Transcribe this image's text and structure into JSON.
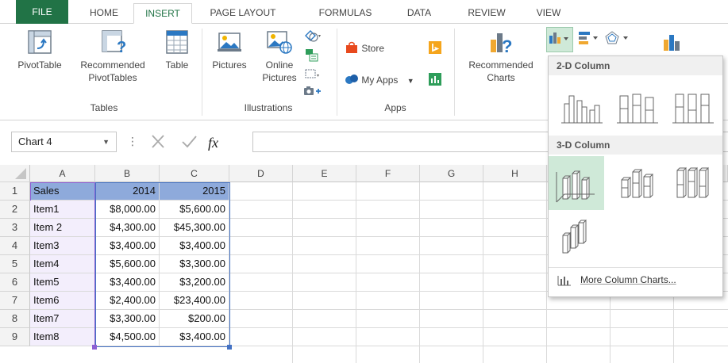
{
  "tabs": [
    "FILE",
    "HOME",
    "INSERT",
    "PAGE LAYOUT",
    "FORMULAS",
    "DATA",
    "REVIEW",
    "VIEW"
  ],
  "active_tab": "INSERT",
  "ribbon": {
    "tables": {
      "label": "Tables",
      "pivottable": "PivotTable",
      "recommended_line1": "Recommended",
      "recommended_line2": "PivotTables",
      "table": "Table"
    },
    "illustrations": {
      "label": "Illustrations",
      "pictures": "Pictures",
      "online_line1": "Online",
      "online_line2": "Pictures"
    },
    "apps": {
      "label": "Apps",
      "store": "Store",
      "myapps": "My Apps"
    },
    "charts": {
      "recommended_line1": "Recommended",
      "recommended_line2": "Charts"
    }
  },
  "namebox": "Chart 4",
  "formula_value": "",
  "columns": [
    "A",
    "B",
    "C",
    "D",
    "E",
    "F",
    "G",
    "H"
  ],
  "rows": [
    [
      "Sales",
      "2014",
      "2015"
    ],
    [
      "Item1",
      "$8,000.00",
      "$5,600.00"
    ],
    [
      "Item 2",
      "$4,300.00",
      "$45,300.00"
    ],
    [
      "Item3",
      "$3,400.00",
      "$3,400.00"
    ],
    [
      "Item4",
      "$5,600.00",
      "$3,300.00"
    ],
    [
      "Item5",
      "$3,400.00",
      "$3,200.00"
    ],
    [
      "Item6",
      "$2,400.00",
      "$23,400.00"
    ],
    [
      "Item7",
      "$3,300.00",
      "$200.00"
    ],
    [
      "Item8",
      "$4,500.00",
      "$3,400.00"
    ]
  ],
  "row_numbers": [
    "1",
    "2",
    "3",
    "4",
    "5",
    "6",
    "7",
    "8",
    "9"
  ],
  "gallery": {
    "section_2d": "2-D Column",
    "section_3d": "3-D Column",
    "more": "More Column Charts..."
  },
  "colors": {
    "excel_green": "#217346",
    "header_blue": "#8eaadb",
    "highlight_green": "#cfe9d8"
  }
}
